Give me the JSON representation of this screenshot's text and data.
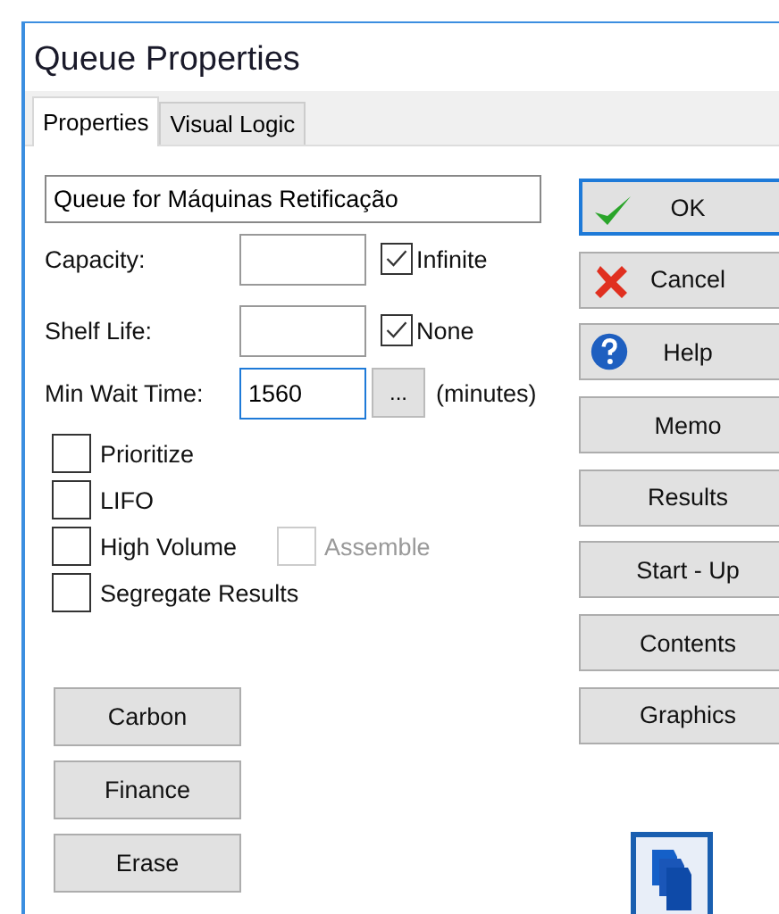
{
  "window": {
    "title": "Queue Properties"
  },
  "tabs": [
    {
      "label": "Properties",
      "selected": true
    },
    {
      "label": "Visual Logic",
      "selected": false
    }
  ],
  "name_field": {
    "value": "Queue for Máquinas Retificação"
  },
  "fields": [
    {
      "kind": "check",
      "label": "Capacity:",
      "focused": false,
      "check": {
        "label": "Infinite",
        "checked": true
      }
    },
    {
      "kind": "check",
      "label": "Shelf Life:",
      "focused": false,
      "check": {
        "label": "None",
        "checked": true
      }
    },
    {
      "kind": "browse",
      "label": "Min Wait Time:",
      "value": "1560",
      "focused": true,
      "browse": "...",
      "unit": "(minutes)"
    }
  ],
  "options": [
    {
      "label": "Prioritize",
      "checked": false
    },
    {
      "label": "LIFO",
      "checked": false
    },
    {
      "label": "High Volume",
      "checked": false,
      "side": {
        "label": "Assemble",
        "checked": false,
        "disabled": true
      }
    },
    {
      "label": "Segregate Results",
      "checked": false
    }
  ],
  "left_buttons": [
    "Carbon",
    "Finance",
    "Erase"
  ],
  "right_buttons": [
    {
      "label": "OK",
      "kind": "check",
      "default": true
    },
    {
      "label": "Cancel",
      "kind": "cross",
      "default": false
    },
    {
      "label": "Help",
      "kind": "help",
      "default": false
    },
    {
      "label": "Memo",
      "default": false
    },
    {
      "label": "Results",
      "default": false
    },
    {
      "label": "Start - Up",
      "default": false
    },
    {
      "label": "Contents",
      "default": false
    },
    {
      "label": "Graphics",
      "default": false
    }
  ]
}
